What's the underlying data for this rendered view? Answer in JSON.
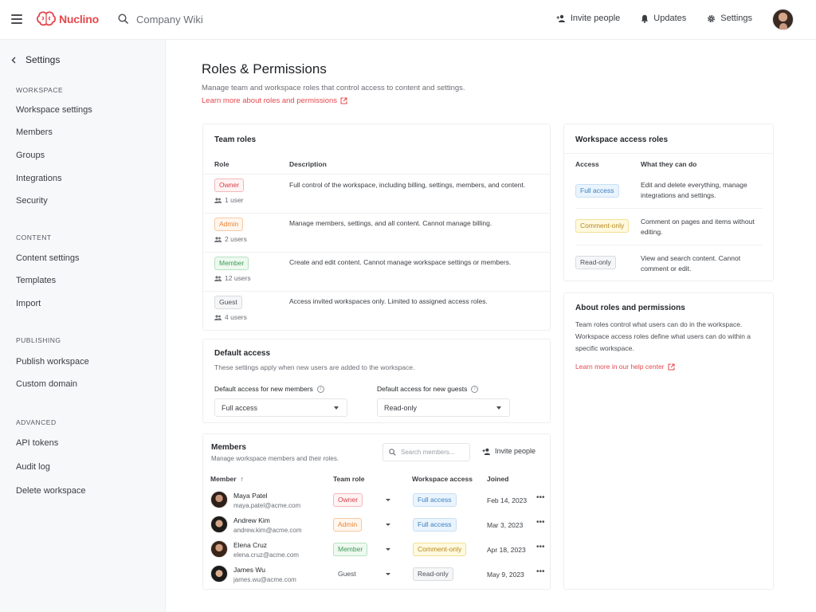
{
  "app": {
    "name": "Nuclino",
    "wiki_title": "Company Wiki"
  },
  "topbar": {
    "actions": [
      {
        "label": "Invite people",
        "icon": "invite-person-icon"
      },
      {
        "label": "Updates",
        "icon": "bell-icon"
      },
      {
        "label": "Settings",
        "icon": "gear-icon"
      }
    ]
  },
  "sidebar": {
    "back_label": "Settings",
    "sections": [
      {
        "title": "WORKSPACE",
        "items": [
          "Workspace settings",
          "Members",
          "Groups",
          "Integrations",
          "Security"
        ]
      },
      {
        "title": "CONTENT",
        "items": [
          "Content settings",
          "Templates",
          "Import"
        ]
      },
      {
        "title": "PUBLISHING",
        "items": [
          "Publish workspace",
          "Custom domain"
        ]
      },
      {
        "title": "ADVANCED",
        "items": [
          "API tokens",
          "Audit log",
          "Delete workspace"
        ]
      }
    ]
  },
  "page": {
    "title": "Roles & Permissions",
    "description": "Manage team and workspace roles that control access to content and settings.",
    "link": "Learn more about roles and permissions"
  },
  "team_roles": {
    "title": "Team roles",
    "col_role": "Role",
    "col_desc": "Description",
    "rows": [
      {
        "role": "Owner",
        "users": "1 user",
        "desc": "Full control of the workspace, including billing, settings, members, and content."
      },
      {
        "role": "Admin",
        "users": "2 users",
        "desc": "Manage members, settings, and all content. Cannot manage billing."
      },
      {
        "role": "Member",
        "users": "12 users",
        "desc": "Create and edit content. Cannot manage workspace settings or members."
      },
      {
        "role": "Guest",
        "users": "4 users",
        "desc": "Access invited workspaces only. Limited to assigned access roles."
      }
    ]
  },
  "default_access": {
    "title": "Default access",
    "description": "These settings apply when new users are added to the workspace.",
    "members_label": "Default access for new members",
    "members_value": "Full access",
    "guests_label": "Default access for new guests",
    "guests_value": "Read-only"
  },
  "members": {
    "title": "Members",
    "description": "Manage workspace members and their roles.",
    "search_placeholder": "Search members...",
    "invite_label": "Invite people",
    "col_member": "Member",
    "sort_arrow": "↑",
    "col_team_role": "Team role",
    "col_workspace_access": "Workspace access",
    "col_joined": "Joined",
    "rows": [
      {
        "name": "Maya Patel",
        "email": "maya.patel@acme.com",
        "role": "Owner",
        "access": "Full access",
        "joined": "Feb 14, 2023"
      },
      {
        "name": "Andrew Kim",
        "email": "andrew.kim@acme.com",
        "role": "Admin",
        "access": "Full access",
        "joined": "Mar 3, 2023"
      },
      {
        "name": "Elena Cruz",
        "email": "elena.cruz@acme.com",
        "role": "Member",
        "access": "Comment-only",
        "joined": "Apr 18, 2023"
      },
      {
        "name": "James Wu",
        "email": "james.wu@acme.com",
        "role": "Guest",
        "access": "Read-only",
        "joined": "May 9, 2023"
      }
    ]
  },
  "workspace_roles": {
    "title": "Workspace access roles",
    "col_access": "Access",
    "col_what": "What they can do",
    "rows": [
      {
        "access": "Full access",
        "desc": "Edit and delete everything, manage integrations and settings."
      },
      {
        "access": "Comment-only",
        "desc": "Comment on pages and items without editing."
      },
      {
        "access": "Read-only",
        "desc": "View and search content. Cannot comment or edit."
      }
    ]
  },
  "about": {
    "title": "About roles and permissions",
    "text": "Team roles control what users can do in the workspace. Workspace access roles define what users can do within a specific workspace.",
    "link": "Learn more in our help center"
  },
  "colors": {
    "brand": "#e5484d",
    "owner": "#d6404a",
    "admin": "#e7853a",
    "member": "#3f9a55",
    "guest": "#4c5057",
    "full_access": "#3a7fc0",
    "comment_only": "#b8881a"
  }
}
